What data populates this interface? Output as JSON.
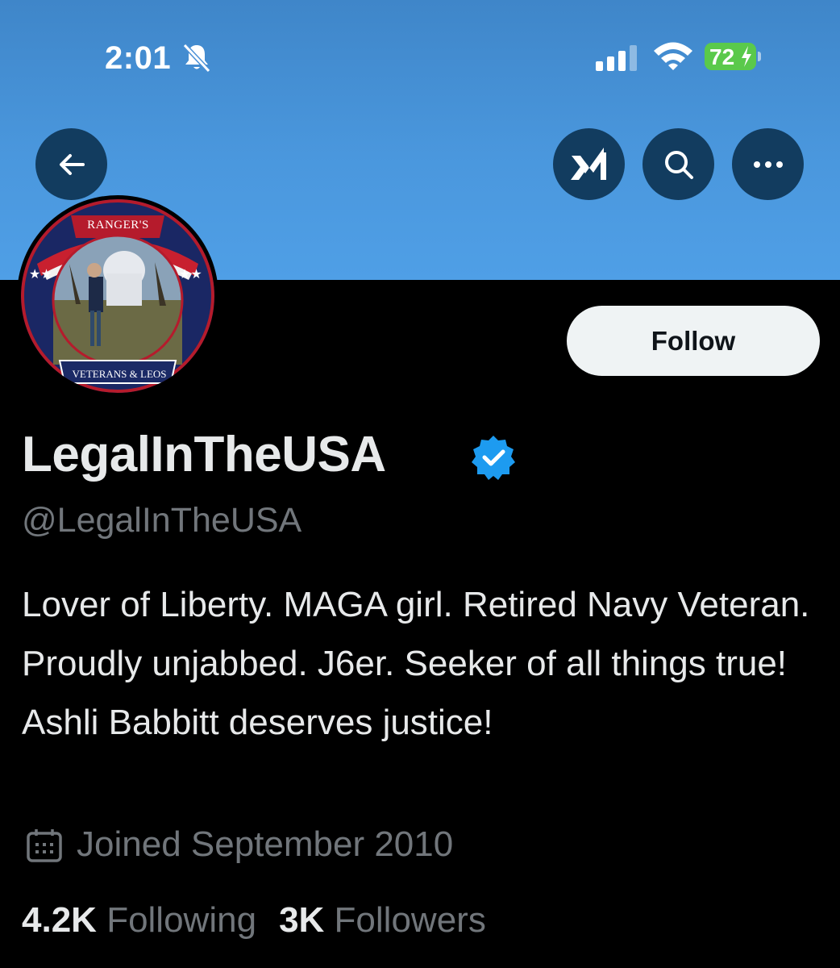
{
  "status_bar": {
    "time": "2:01",
    "battery": "72"
  },
  "header": {
    "back_icon": "back-arrow-icon",
    "grok_icon": "grok-icon",
    "search_icon": "search-icon",
    "more_icon": "more-icon"
  },
  "avatar": {
    "top_text": "RANGER'S",
    "bottom_text": "VETERANS & LEOS"
  },
  "profile": {
    "follow_label": "Follow",
    "display_name": "LegalInTheUSA",
    "handle": "@LegalInTheUSA",
    "bio": "Lover of Liberty. MAGA girl. Retired Navy Veteran. Proudly unjabbed. J6er. Seeker of all things true! Ashli Babbitt deserves justice!",
    "joined": "Joined September 2010",
    "following_count": "4.2K",
    "following_label": "Following",
    "followers_count": "3K",
    "followers_label": "Followers"
  },
  "colors": {
    "banner": "#4a97dd",
    "verified": "#1d9bf0",
    "battery": "#5ac94b"
  }
}
